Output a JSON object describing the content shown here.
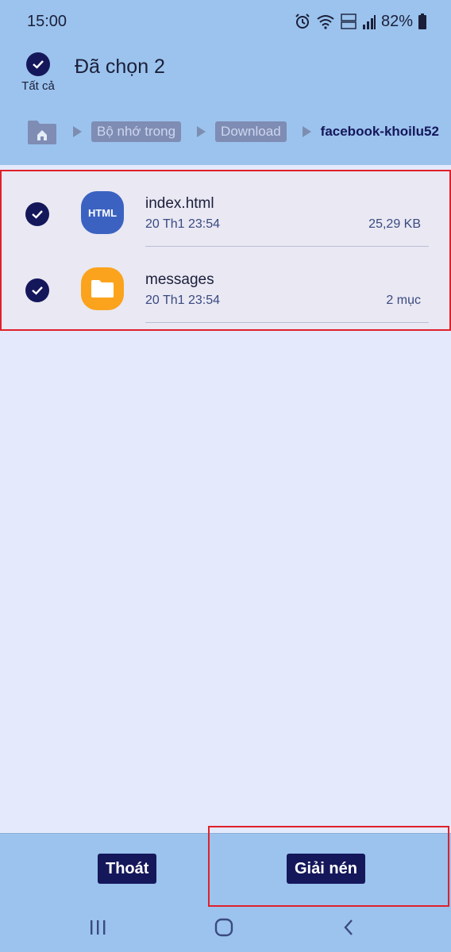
{
  "status_bar": {
    "time": "15:00",
    "battery": "82%",
    "icons": [
      "alarm-icon",
      "wifi-icon",
      "volte-icon",
      "signal-icon",
      "battery-icon"
    ]
  },
  "header": {
    "select_all_label": "Tất cả",
    "title": "Đã chọn 2"
  },
  "breadcrumb": {
    "items": [
      "Bộ nhớ trong",
      "Download"
    ],
    "current": "facebook-khoilu52"
  },
  "files": [
    {
      "name": "index.html",
      "date": "20 Th1 23:54",
      "size": "25,29 KB",
      "icon": "html-file-icon",
      "icon_text": "HTML"
    },
    {
      "name": "messages",
      "date": "20 Th1 23:54",
      "size": "2 mục",
      "icon": "folder-icon"
    }
  ],
  "bottom_bar": {
    "exit_label": "Thoát",
    "extract_label": "Giải nén"
  },
  "colors": {
    "header_bg": "#9bc3ed",
    "accent": "#15175b",
    "list_bg": "#e9e8f3",
    "html_icon": "#3b62c1",
    "folder_icon": "#fba31c",
    "highlight": "#e0202a"
  }
}
